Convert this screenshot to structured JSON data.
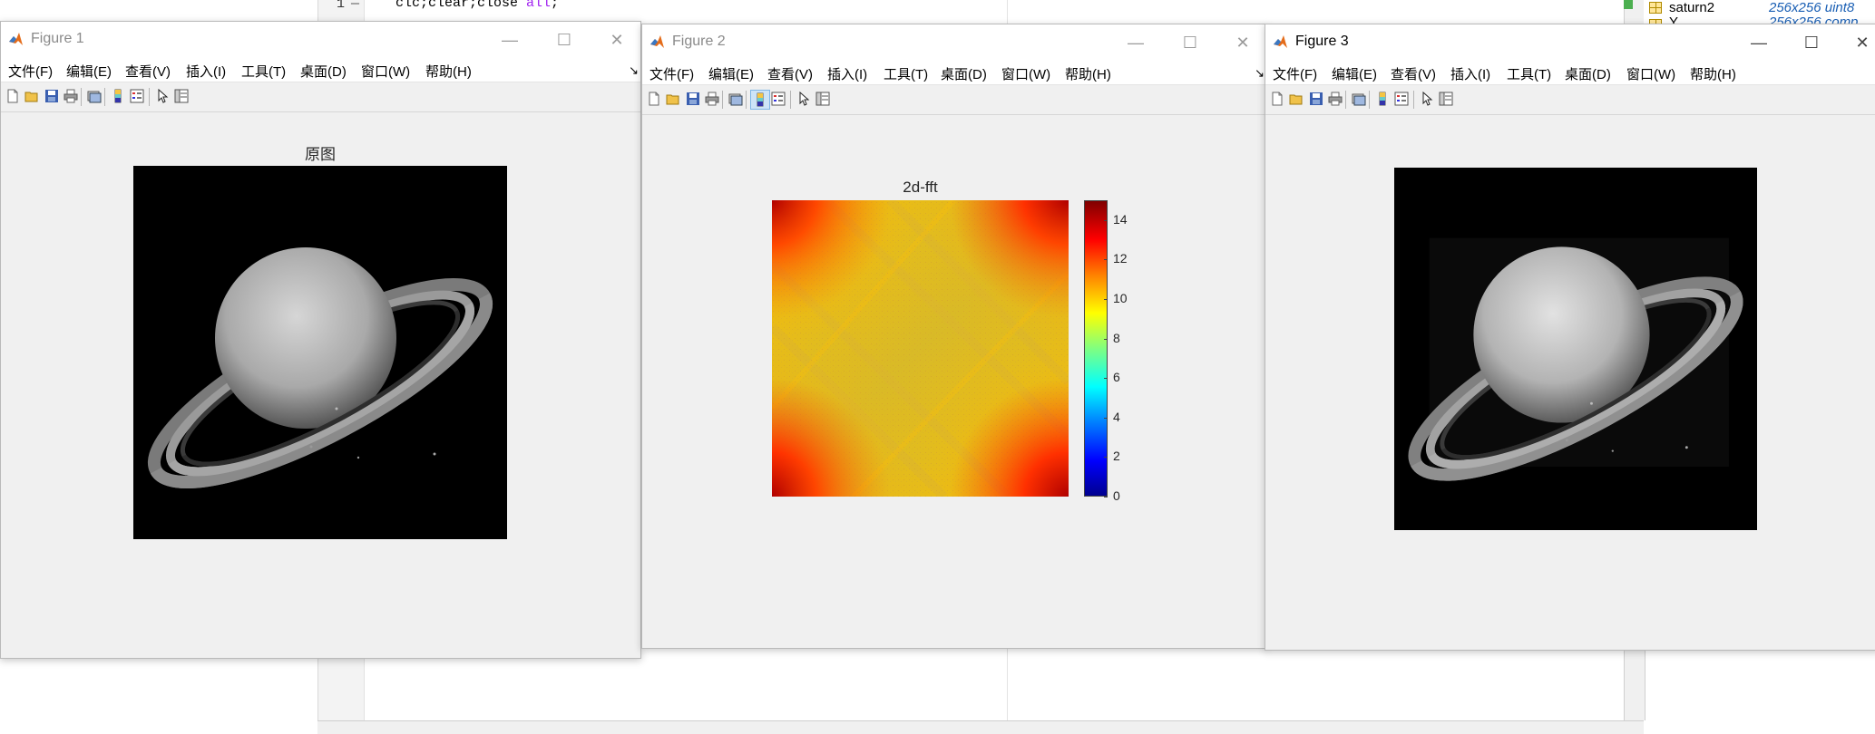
{
  "editor": {
    "line_number": "1",
    "code_prefix": "clc;clear;close ",
    "code_keyword": "all",
    "code_suffix": ";"
  },
  "workspace": {
    "rows": [
      {
        "name": "saturn2",
        "value": "256x256 uint8"
      },
      {
        "name": "Y",
        "value": "256x256 comp"
      }
    ]
  },
  "menu": {
    "file": "文件(F)",
    "edit": "编辑(E)",
    "view": "查看(V)",
    "insert": "插入(I)",
    "tools": "工具(T)",
    "desktop": "桌面(D)",
    "window": "窗口(W)",
    "help": "帮助(H)",
    "more": "↘"
  },
  "window_controls": {
    "minimize": "—",
    "maximize": "☐",
    "close": "✕"
  },
  "figures": [
    {
      "title": "Figure 1",
      "axes_title": "原图",
      "active": false
    },
    {
      "title": "Figure 2",
      "axes_title": "2d-fft",
      "active": false
    },
    {
      "title": "Figure 3",
      "axes_title": "",
      "active": true
    }
  ],
  "colorbar": {
    "ticks": [
      "14",
      "12",
      "10",
      "8",
      "6",
      "4",
      "2",
      "0"
    ],
    "range": [
      0,
      15
    ],
    "colormap": "jet"
  },
  "icons": {
    "app": "matlab-logo-icon",
    "toolbar": [
      "new-figure-icon",
      "open-file-icon",
      "save-icon",
      "print-icon",
      "print-preview-icon",
      "colorbar-icon",
      "legend-icon",
      "pointer-icon",
      "property-inspector-icon"
    ]
  }
}
